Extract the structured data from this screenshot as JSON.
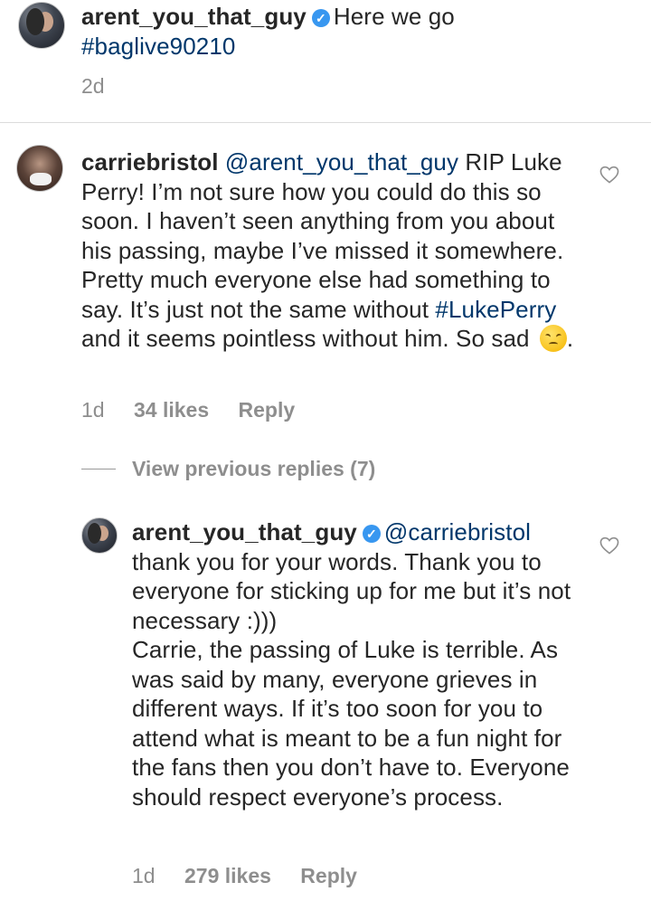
{
  "post": {
    "username": "arent_you_that_guy",
    "verified": true,
    "caption": "Here we go",
    "hashtag": "#baglive90210",
    "time": "2d"
  },
  "comment": {
    "username": "carriebristol",
    "mention": "@arent_you_that_guy",
    "text_1": "RIP Luke Perry! I’m not sure how you could do this so soon. I haven’t seen anything from you about his passing, maybe I’ve missed it somewhere. Pretty much everyone else had something to say. It’s just not the same without",
    "hashtag": "#LukePerry",
    "text_2": "and it seems pointless without him. So sad",
    "text_3": ".",
    "emoji": "disappointed-face",
    "time": "1d",
    "likes": "34 likes",
    "reply_label": "Reply"
  },
  "view_previous": "View previous replies (7)",
  "reply": {
    "username": "arent_you_that_guy",
    "verified": true,
    "mention": "@carriebristol",
    "text_1": "thank you for your words. Thank you to everyone for sticking up for me but it’s not necessary :)))",
    "text_2": "Carrie, the passing of Luke is terrible. As was said by many, everyone grieves in different ways. If it’s too soon for you to attend what is meant to be a fun night for the fans then you don’t have to. Everyone should respect everyone’s process.",
    "time": "1d",
    "likes": "279 likes",
    "reply_label": "Reply"
  },
  "colors": {
    "link": "#00376b",
    "meta": "#8e8e8e",
    "verified": "#3897f0",
    "divider": "#dbdbdb"
  }
}
